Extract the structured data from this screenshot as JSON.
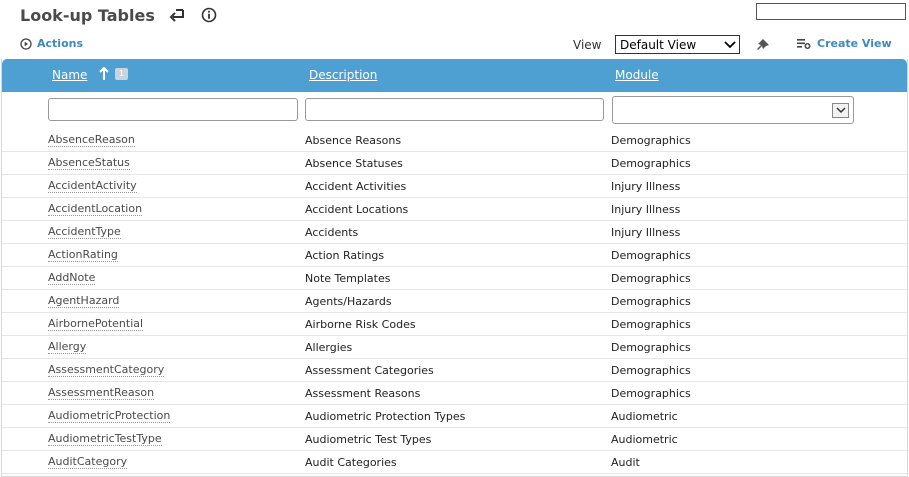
{
  "page": {
    "title": "Look-up Tables"
  },
  "toolbar": {
    "actions_label": "Actions",
    "view_label": "View",
    "view_selected": "Default View",
    "create_view_label": "Create View",
    "search_value": ""
  },
  "table": {
    "columns": {
      "name": "Name",
      "description": "Description",
      "module": "Module"
    },
    "sort_badge": "1",
    "rows": [
      {
        "name": "AbsenceReason",
        "description": "Absence Reasons",
        "module": "Demographics"
      },
      {
        "name": "AbsenceStatus",
        "description": "Absence Statuses",
        "module": "Demographics"
      },
      {
        "name": "AccidentActivity",
        "description": "Accident Activities",
        "module": "Injury Illness"
      },
      {
        "name": "AccidentLocation",
        "description": "Accident Locations",
        "module": "Injury Illness"
      },
      {
        "name": "AccidentType",
        "description": "Accidents",
        "module": "Injury Illness"
      },
      {
        "name": "ActionRating",
        "description": "Action Ratings",
        "module": "Demographics"
      },
      {
        "name": "AddNote",
        "description": "Note Templates",
        "module": "Demographics"
      },
      {
        "name": "AgentHazard",
        "description": "Agents/Hazards",
        "module": "Demographics"
      },
      {
        "name": "AirbornePotential",
        "description": "Airborne Risk Codes",
        "module": "Demographics"
      },
      {
        "name": "Allergy",
        "description": "Allergies",
        "module": "Demographics"
      },
      {
        "name": "AssessmentCategory",
        "description": "Assessment Categories",
        "module": "Demographics"
      },
      {
        "name": "AssessmentReason",
        "description": "Assessment Reasons",
        "module": "Demographics"
      },
      {
        "name": "AudiometricProtection",
        "description": "Audiometric Protection Types",
        "module": "Audiometric"
      },
      {
        "name": "AudiometricTestType",
        "description": "Audiometric Test Types",
        "module": "Audiometric"
      },
      {
        "name": "AuditCategory",
        "description": "Audit Categories",
        "module": "Audit"
      }
    ]
  },
  "colors": {
    "header_bg": "#4e9fd2",
    "link_blue": "#3f89c0"
  },
  "icons": [
    "back-arrow-icon",
    "info-icon",
    "play-circle-icon",
    "pin-icon",
    "create-view-icon",
    "sort-up-icon",
    "chevron-down-icon"
  ]
}
